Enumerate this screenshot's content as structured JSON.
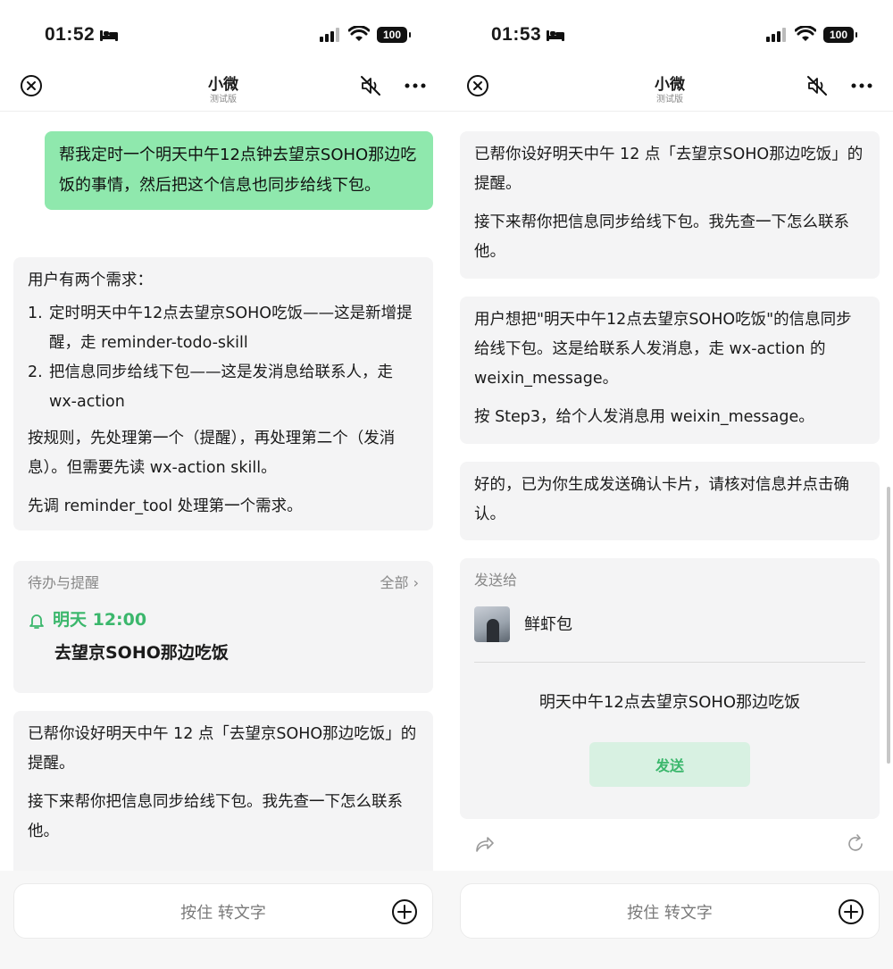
{
  "status_bar": {
    "time_left": "01:52",
    "time_right": "01:53",
    "battery": "100"
  },
  "nav": {
    "title": "小微",
    "subtitle": "测试版"
  },
  "left": {
    "user_message": "帮我定时一个明天中午12点钟去望京SOHO那边吃饭的事情，然后把这个信息也同步给线下包。",
    "thinking": {
      "intro": "用户有两个需求：",
      "items": [
        {
          "num": "1.",
          "text": "定时明天中午12点去望京SOHO吃饭——这是新增提醒，走 reminder-todo-skill"
        },
        {
          "num": "2.",
          "text": "把信息同步给线下包——这是发消息给联系人，走 wx-action"
        }
      ],
      "para1": "按规则，先处理第一个（提醒），再处理第二个（发消息）。但需要先读 wx-action skill。",
      "para2": "先调 reminder_tool 处理第一个需求。"
    },
    "todo": {
      "header": "待办与提醒",
      "all_label": "全部",
      "time": "明天 12:00",
      "task": "去望京SOHO那边吃饭"
    },
    "reply": {
      "p1": "已帮你设好明天中午 12 点「去望京SOHO那边吃饭」的提醒。",
      "p2": "接下来帮你把信息同步给线下包。我先查一下怎么联系他。"
    }
  },
  "right": {
    "reply": {
      "p1": "已帮你设好明天中午 12 点「去望京SOHO那边吃饭」的提醒。",
      "p2": "接下来帮你把信息同步给线下包。我先查一下怎么联系他。"
    },
    "thinking": {
      "p1": "用户想把\"明天中午12点去望京SOHO吃饭\"的信息同步给线下包。这是给联系人发消息，走 wx-action 的 weixin_message。",
      "p2": "按 Step3，给个人发消息用 weixin_message。"
    },
    "confirm_text": "好的，已为你生成发送确认卡片，请核对信息并点击确认。",
    "send_card": {
      "label": "发送给",
      "contact_name": "鲜虾包",
      "message": "明天中午12点去望京SOHO那边吃饭",
      "button": "发送"
    }
  },
  "input": {
    "hold_to_talk": "按住 转文字"
  }
}
